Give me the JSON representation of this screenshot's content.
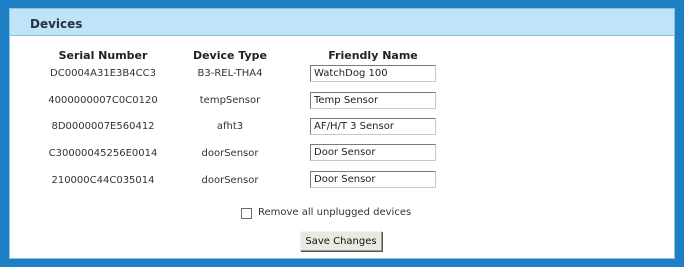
{
  "panel": {
    "title": "Devices"
  },
  "table": {
    "headers": {
      "serial": "Serial Number",
      "type": "Device Type",
      "name": "Friendly Name"
    },
    "rows": [
      {
        "serial": "DC0004A31E3B4CC3",
        "type": "B3-REL-THA4",
        "name": "WatchDog 100"
      },
      {
        "serial": "4000000007C0C0120",
        "type": "tempSensor",
        "name": "Temp Sensor"
      },
      {
        "serial": "8D0000007E560412",
        "type": "afht3",
        "name": "AF/H/T 3 Sensor"
      },
      {
        "serial": "C30000045256E0014",
        "type": "doorSensor",
        "name": "Door Sensor"
      },
      {
        "serial": "210000C44C035014",
        "type": "doorSensor",
        "name": "Door Sensor"
      }
    ]
  },
  "options": {
    "remove_unplugged_label": "Remove all unplugged devices",
    "remove_unplugged_checked": false
  },
  "actions": {
    "save_label": "Save Changes"
  }
}
